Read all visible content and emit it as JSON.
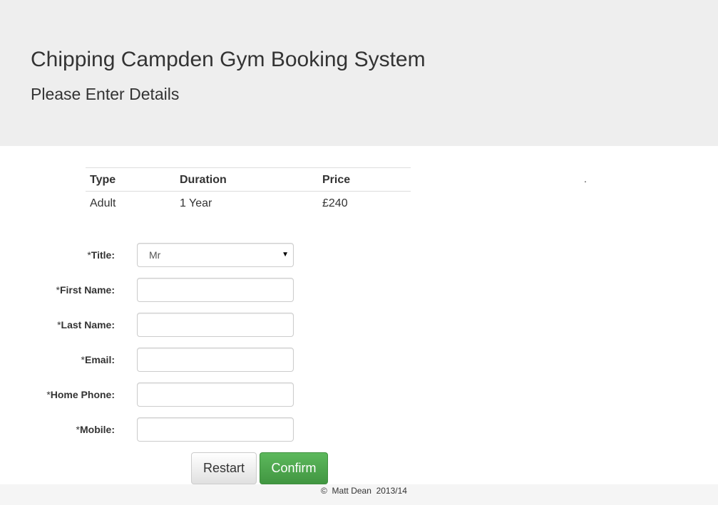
{
  "header": {
    "title": "Chipping Campden Gym Booking System",
    "subtitle": "Please Enter Details"
  },
  "summary_table": {
    "headers": [
      "Type",
      "Duration",
      "Price"
    ],
    "rows": [
      [
        "Adult",
        "1 Year",
        "£240"
      ]
    ]
  },
  "stray_mark": ".",
  "form": {
    "required_marker": "*",
    "title": {
      "label": "Title:",
      "value": "Mr"
    },
    "first_name": {
      "label": "First Name:",
      "value": ""
    },
    "last_name": {
      "label": "Last Name:",
      "value": ""
    },
    "email": {
      "label": "Email:",
      "value": ""
    },
    "home_phone": {
      "label": "Home Phone:",
      "value": ""
    },
    "mobile": {
      "label": "Mobile:",
      "value": ""
    }
  },
  "buttons": {
    "restart": "Restart",
    "confirm": "Confirm"
  },
  "footer": {
    "copyright": "©  Matt Dean  2013/14"
  },
  "colors": {
    "header_bg": "#eeeeee",
    "confirm_green": "#449d44",
    "footer_bg": "#f5f5f5"
  }
}
